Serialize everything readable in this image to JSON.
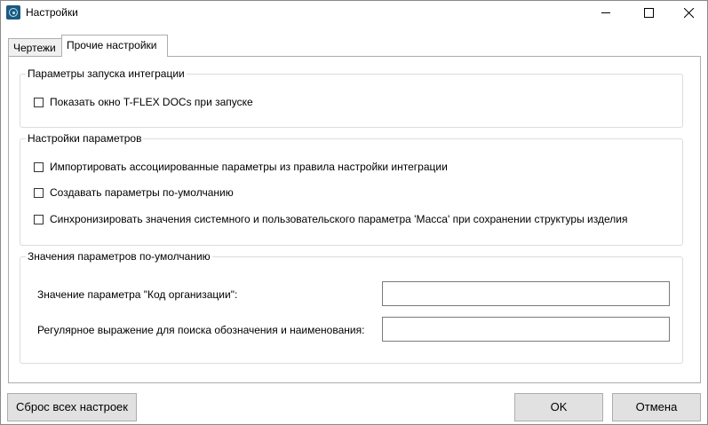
{
  "window": {
    "title": "Настройки",
    "app_icon": "tflex-icon"
  },
  "tabs": [
    {
      "label": "Чертежи",
      "active": false
    },
    {
      "label": "Прочие настройки",
      "active": true
    }
  ],
  "groups": {
    "launch": {
      "title": "Параметры запуска интеграции",
      "show_window": {
        "label": "Показать окно T-FLEX DOCs при запуске",
        "checked": false
      }
    },
    "params": {
      "title": "Настройки параметров",
      "import_assoc": {
        "label": "Импортировать ассоциированные параметры из правила настройки интеграции",
        "checked": false
      },
      "create_default": {
        "label": "Создавать параметры по-умолчанию",
        "checked": false
      },
      "sync_mass": {
        "label": "Синхронизировать значения системного и пользовательского параметра 'Масса' при сохранении структуры изделия",
        "checked": false
      }
    },
    "defaults": {
      "title": "Значения параметров по-умолчанию",
      "org_code": {
        "label": "Значение параметра \"Код организации\":",
        "value": ""
      },
      "regex": {
        "label": "Регулярное выражение для поиска обозначения и наименования:",
        "value": ""
      }
    }
  },
  "buttons": {
    "reset": "Сброс всех настроек",
    "ok": "OK",
    "cancel": "Отмена"
  }
}
